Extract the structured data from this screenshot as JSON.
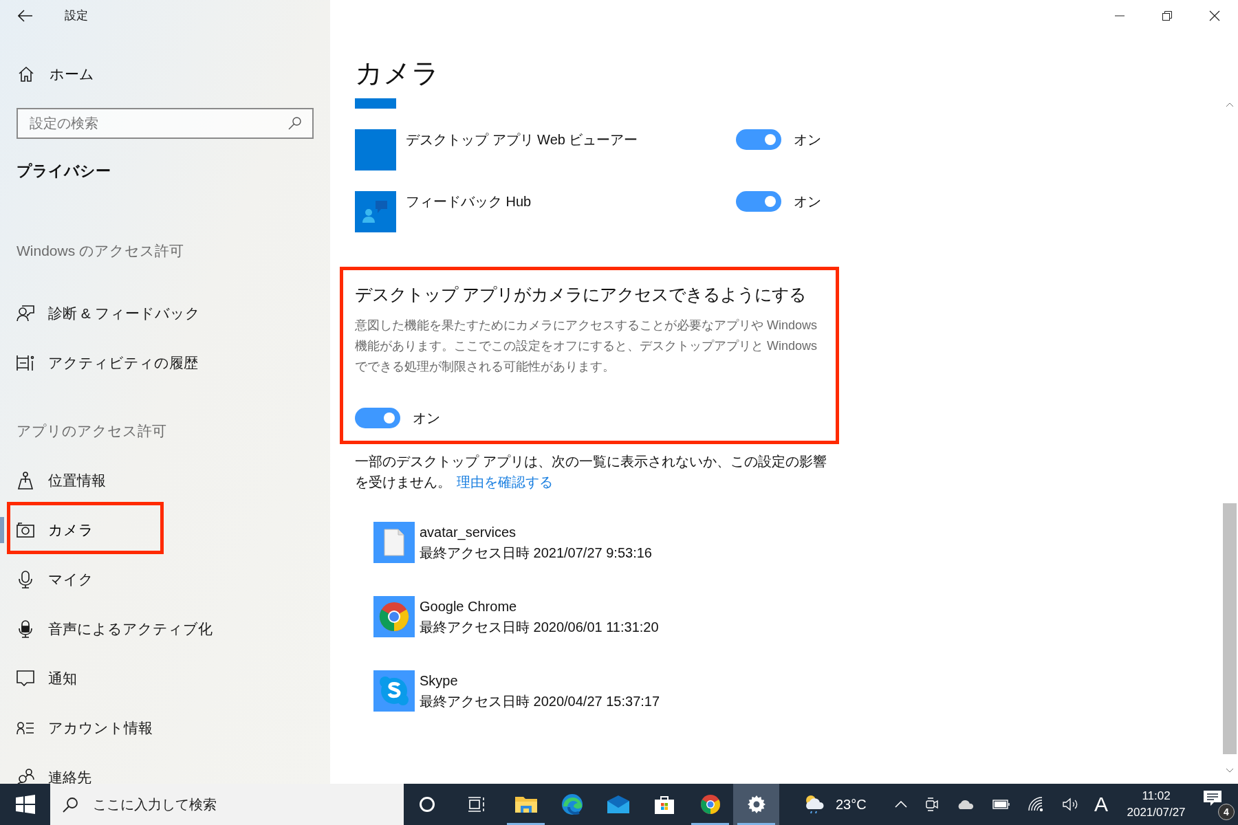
{
  "window": {
    "title": "設定"
  },
  "sidebar": {
    "home": "ホーム",
    "search": {
      "placeholder": "設定の検索"
    },
    "section_title": "プライバシー",
    "groups": [
      {
        "heading": "Windows のアクセス許可",
        "items": [
          {
            "kind": "diagnostics",
            "label": "診断 & フィードバック",
            "selected": false,
            "highlighted": false
          },
          {
            "kind": "activity",
            "label": "アクティビティの履歴",
            "selected": false,
            "highlighted": false
          }
        ]
      },
      {
        "heading": "アプリのアクセス許可",
        "items": [
          {
            "kind": "location",
            "label": "位置情報",
            "selected": false,
            "highlighted": false
          },
          {
            "kind": "camera",
            "label": "カメラ",
            "selected": true,
            "highlighted": true
          },
          {
            "kind": "mic",
            "label": "マイク",
            "selected": false,
            "highlighted": false
          },
          {
            "kind": "voice",
            "label": "音声によるアクティブ化",
            "selected": false,
            "highlighted": false
          },
          {
            "kind": "notifications",
            "label": "通知",
            "selected": false,
            "highlighted": false
          },
          {
            "kind": "account",
            "label": "アカウント情報",
            "selected": false,
            "highlighted": false
          },
          {
            "kind": "contacts",
            "label": "連絡先",
            "selected": false,
            "highlighted": false
          }
        ]
      }
    ]
  },
  "page": {
    "title": "カメラ",
    "apps": [
      {
        "kind": "web-viewer",
        "name": "デスクトップ アプリ Web ビューアー",
        "on": true,
        "state_label": "オン"
      },
      {
        "kind": "feedback",
        "name": "フィードバック Hub",
        "on": true,
        "state_label": "オン"
      }
    ],
    "desktop_access": {
      "highlighted": true,
      "title": "デスクトップ アプリがカメラにアクセスできるようにする",
      "description": "意図した機能を果たすためにカメラにアクセスすることが必要なアプリや Windows 機能があります。ここでこの設定をオフにすると、デスクトップアプリと Windows でできる処理が制限される可能性があります。",
      "on": true,
      "state_label": "オン"
    },
    "note": {
      "text": "一部のデスクトップ アプリは、次の一覧に表示されないか、この設定の影響を受けません。",
      "link": "理由を確認する"
    },
    "recent": [
      {
        "kind": "file",
        "name": "avatar_services",
        "last_access": "最終アクセス日時 2021/07/27 9:53:16"
      },
      {
        "kind": "chrome",
        "name": "Google Chrome",
        "last_access": "最終アクセス日時 2020/06/01 11:31:20"
      },
      {
        "kind": "skype",
        "name": "Skype",
        "last_access": "最終アクセス日時 2020/04/27 15:37:17"
      }
    ]
  },
  "taskbar": {
    "search": {
      "placeholder": "ここに入力して検索"
    },
    "apps": [
      {
        "kind": "cortana",
        "running": false,
        "active": false
      },
      {
        "kind": "taskview",
        "running": false,
        "active": false
      },
      {
        "kind": "explorer",
        "running": true,
        "active": false
      },
      {
        "kind": "edge",
        "running": false,
        "active": false
      },
      {
        "kind": "mail",
        "running": false,
        "active": false
      },
      {
        "kind": "store",
        "running": false,
        "active": false
      },
      {
        "kind": "chrome",
        "running": true,
        "active": false
      },
      {
        "kind": "settings",
        "running": true,
        "active": true
      }
    ],
    "weather": "23°C",
    "ime": "A",
    "time": "11:02",
    "date": "2021/07/27",
    "notifications": "4"
  }
}
